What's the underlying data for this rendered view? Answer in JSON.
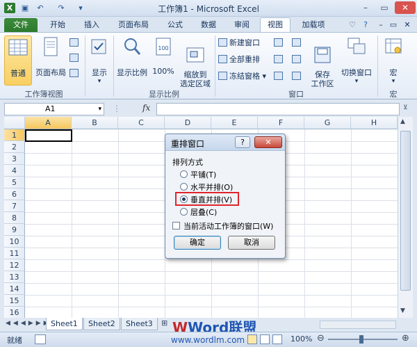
{
  "window": {
    "title": "工作簿1 - Microsoft Excel"
  },
  "tabs": [
    "文件",
    "开始",
    "插入",
    "页面布局",
    "公式",
    "数据",
    "审阅",
    "视图",
    "加载项"
  ],
  "ribbon": {
    "workbook_views": {
      "normal": "普通",
      "page_layout": "页面布局",
      "group": "工作簿视图"
    },
    "show": {
      "label": "显示"
    },
    "zoom": {
      "zoom": "显示比例",
      "hundred": "100%",
      "zoom_sel": "缩放到\n选定区域",
      "group": "显示比例"
    },
    "window": {
      "new_window": "新建窗口",
      "arrange_all": "全部重排",
      "freeze": "冻结窗格",
      "save_ws": "保存\n工作区",
      "switch": "切换窗口",
      "group": "窗口"
    },
    "macro": {
      "label": "宏",
      "group": "宏"
    }
  },
  "formula_bar": {
    "name_box": "A1",
    "fx": "fx"
  },
  "grid": {
    "columns": [
      "A",
      "B",
      "C",
      "D",
      "E",
      "F",
      "G",
      "H"
    ],
    "rows": [
      "1",
      "2",
      "3",
      "4",
      "5",
      "6",
      "7",
      "8",
      "9",
      "10",
      "11",
      "12",
      "13",
      "14",
      "15",
      "16"
    ]
  },
  "sheets": [
    "Sheet1",
    "Sheet2",
    "Sheet3"
  ],
  "status": {
    "ready": "就绪",
    "zoom": "100%"
  },
  "watermark": {
    "brand": "Word联盟",
    "url": "www.wordlm.com"
  },
  "dialog": {
    "title": "重排窗口",
    "help": "?",
    "close": "✕",
    "section": "排列方式",
    "options": [
      "平铺(T)",
      "水平并排(O)",
      "垂直并排(V)",
      "层叠(C)"
    ],
    "checkbox": "当前活动工作簿的窗口(W)",
    "ok": "确定",
    "cancel": "取消"
  }
}
